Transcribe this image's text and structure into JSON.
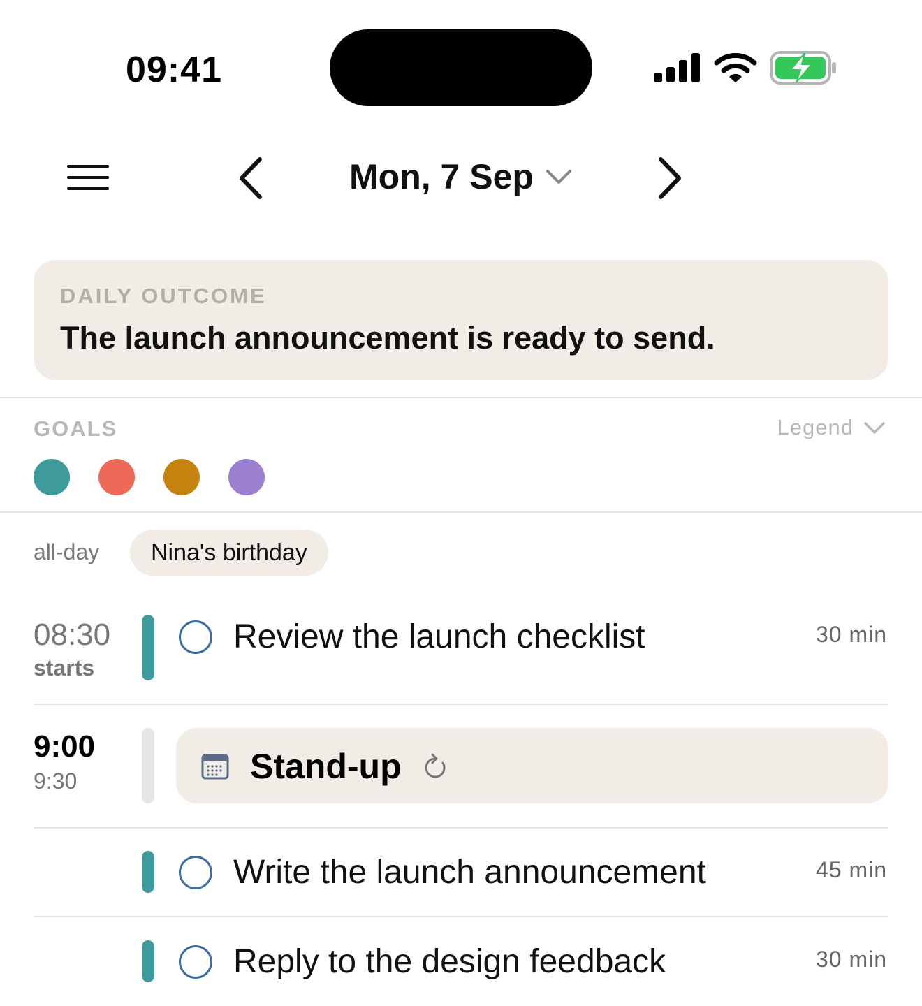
{
  "status_bar": {
    "time": "09:41",
    "icons": [
      "signal-icon",
      "wifi-icon",
      "battery-charging-icon"
    ],
    "battery_color": "#34c759"
  },
  "header": {
    "date_label": "Mon, 7 Sep",
    "icons": [
      "menu-icon",
      "chevron-left-icon",
      "chevron-down-icon",
      "chevron-right-icon"
    ]
  },
  "daily_outcome": {
    "label": "DAILY OUTCOME",
    "text": "The launch announcement is ready to send."
  },
  "goals": {
    "label": "GOALS",
    "legend_label": "Legend",
    "dots": [
      {
        "color": "#3f9a9b"
      },
      {
        "color": "#ee6a58"
      },
      {
        "color": "#c6820f"
      },
      {
        "color": "#9b7fd1"
      }
    ]
  },
  "all_day": {
    "label": "all-day",
    "event": "Nina's birthday"
  },
  "timeline": {
    "task1": {
      "time": "08:30",
      "sub": "starts",
      "title": "Review the launch checklist",
      "duration": "30 min",
      "goal_color": "#3f9a9b"
    },
    "event": {
      "start": "9:00",
      "end": "9:30",
      "title": "Stand-up",
      "icons": [
        "calendar-icon",
        "repeat-icon"
      ]
    },
    "task2": {
      "title": "Write the launch announcement",
      "duration": "45 min",
      "goal_color": "#3f9a9b"
    },
    "task3": {
      "title": "Reply to the design feedback",
      "duration": "30 min",
      "goal_color": "#3f9a9b"
    }
  },
  "colors": {
    "card_bg": "#f1ede6",
    "circle_outline": "#3a6ea3"
  }
}
